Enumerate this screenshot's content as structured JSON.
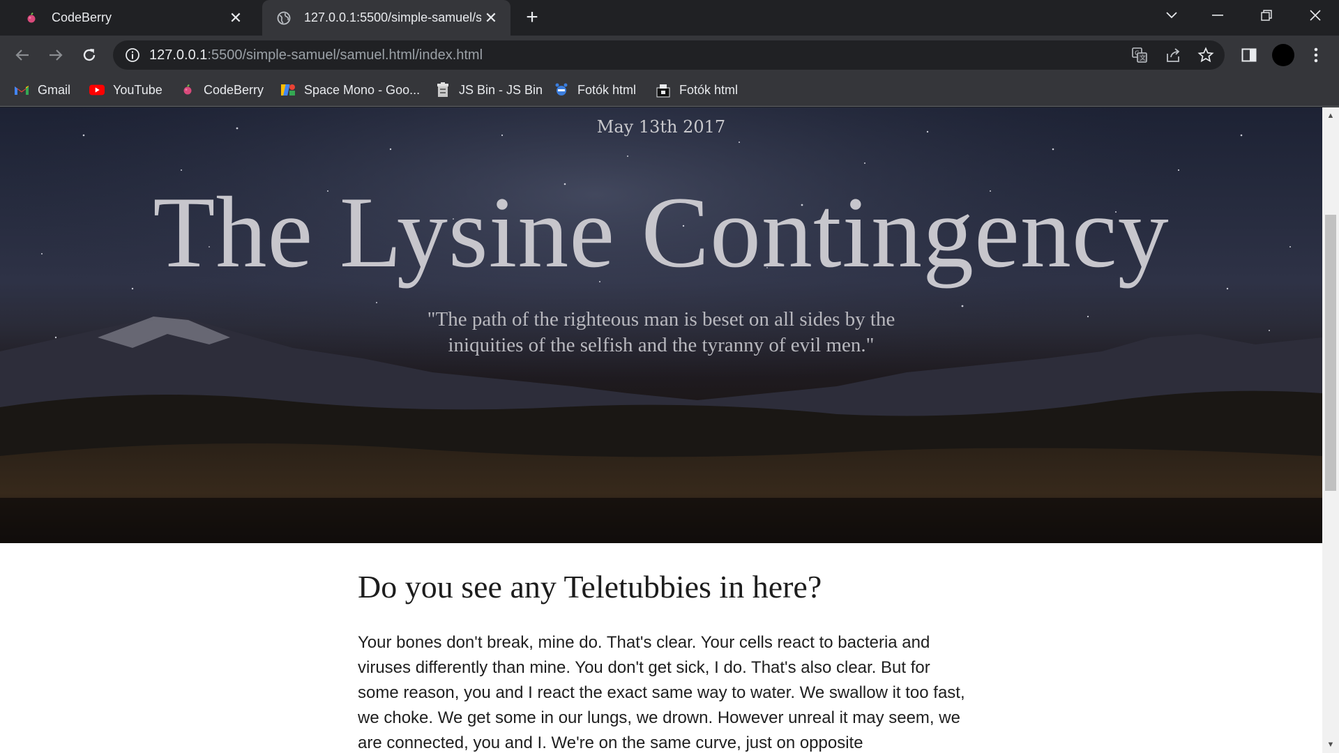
{
  "browser": {
    "tabs": [
      {
        "title": "CodeBerry",
        "icon": "codeberry-icon",
        "active": false
      },
      {
        "title": "127.0.0.1:5500/simple-samuel/sam",
        "icon": "globe-icon",
        "active": true
      }
    ],
    "new_tab_label": "+",
    "address": {
      "host": "127.0.0.1",
      "path": ":5500/simple-samuel/samuel.html/index.html"
    },
    "bookmarks": [
      {
        "label": "Gmail",
        "icon": "gmail-icon"
      },
      {
        "label": "YouTube",
        "icon": "youtube-icon"
      },
      {
        "label": "CodeBerry",
        "icon": "codeberry-icon"
      },
      {
        "label": "Space Mono - Goo...",
        "icon": "google-fonts-icon"
      },
      {
        "label": "JS Bin - JS Bin",
        "icon": "jsbin-icon"
      },
      {
        "label": "Fotók html",
        "icon": "fotok-icon"
      },
      {
        "label": "Fotók html",
        "icon": "fotok-icon"
      }
    ]
  },
  "page": {
    "date": "May 13th 2017",
    "title": "The Lysine Contingency",
    "quote": "\"The path of the righteous man is beset on all sides by the iniquities of the selfish and the tyranny of evil men.\"",
    "heading": "Do you see any Teletubbies in here?",
    "paragraph": "Your bones don't break, mine do. That's clear. Your cells react to bacteria and viruses differently than mine. You don't get sick, I do. That's also clear. But for some reason, you and I react the exact same way to water. We swallow it too fast, we choke. We get some in our lungs, we drown. However unreal it may seem, we are connected, you and I. We're on the same curve, just on opposite"
  },
  "colors": {
    "tabstrip": "#202124",
    "toolbar": "#35363a",
    "youtube_red": "#ff0000",
    "hero_title": "#c7c6cc"
  }
}
